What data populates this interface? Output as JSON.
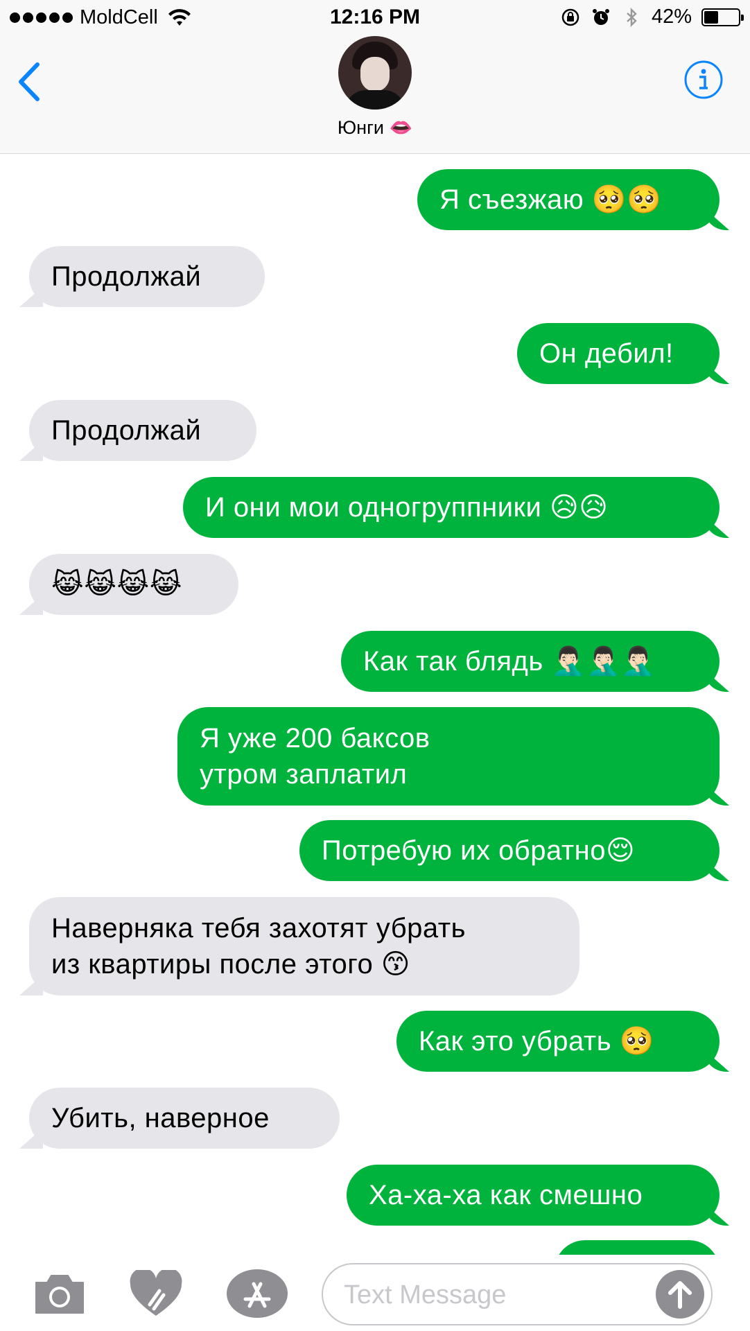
{
  "status": {
    "carrier": "MoldCell",
    "time": "12:16 PM",
    "battery_pct": "42%",
    "battery_level": 0.42
  },
  "header": {
    "contact_name": "Юнги 👄"
  },
  "messages": [
    {
      "dir": "out",
      "text": "Я съезжаю 🥺🥺"
    },
    {
      "dir": "in",
      "text": "Продолжай"
    },
    {
      "dir": "out",
      "text": "Он дебил!"
    },
    {
      "dir": "in",
      "text": "Продолжай"
    },
    {
      "dir": "out",
      "text": "И они мои одногруппники 😥😥"
    },
    {
      "dir": "in",
      "text": "😹😹😹😹"
    },
    {
      "dir": "out",
      "text": "Как так блядь 🤦🏻‍♂️🤦🏻‍♂️🤦🏻‍♂️"
    },
    {
      "dir": "out",
      "text": "Я уже 200 баксов\nутром заплатил"
    },
    {
      "dir": "out",
      "text": "Потребую их обратно😌"
    },
    {
      "dir": "in",
      "text": "Наверняка тебя захотят убрать\nиз квартиры после этого 😙"
    },
    {
      "dir": "out",
      "text": "Как это убрать 🥺"
    },
    {
      "dir": "in",
      "text": "Убить, наверное"
    },
    {
      "dir": "out",
      "text": "Ха-ха-ха как смешно"
    }
  ],
  "input": {
    "placeholder": "Text Message"
  },
  "colors": {
    "outgoing_bubble": "#00b33c",
    "incoming_bubble": "#e5e5ea",
    "accent": "#0a84ff"
  },
  "icons": [
    "back-chevron-icon",
    "info-icon",
    "camera-icon",
    "digital-touch-heart-icon",
    "app-store-icon",
    "send-arrow-icon",
    "wifi-icon",
    "alarm-icon",
    "bluetooth-icon",
    "rotation-lock-icon"
  ]
}
